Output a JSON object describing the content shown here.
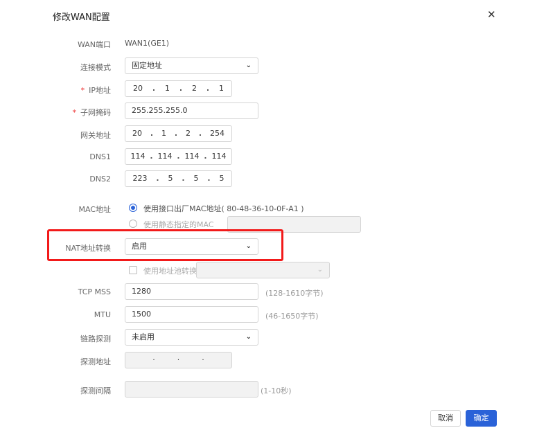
{
  "dialog": {
    "title": "修改WAN配置",
    "close_icon": "close-icon"
  },
  "fields": {
    "wan_port": {
      "label": "WAN端口",
      "value": "WAN1(GE1)"
    },
    "conn_mode": {
      "label": "连接模式",
      "value": "固定地址"
    },
    "ip": {
      "required": "*",
      "label": "IP地址",
      "octets": [
        "20",
        "1",
        "2",
        "1"
      ]
    },
    "subnet": {
      "required": "*",
      "label": "子网掩码",
      "value": "255.255.255.0"
    },
    "gateway": {
      "label": "网关地址",
      "octets": [
        "20",
        "1",
        "2",
        "254"
      ]
    },
    "dns1": {
      "label": "DNS1",
      "octets": [
        "114",
        "114",
        "114",
        "114"
      ]
    },
    "dns2": {
      "label": "DNS2",
      "octets": [
        "223",
        "5",
        "5",
        "5"
      ]
    },
    "mac": {
      "label": "MAC地址",
      "option_factory": "使用接口出厂MAC地址( 80-48-36-10-0F-A1 )",
      "option_static": "使用静态指定的MAC",
      "static_value": ""
    },
    "nat": {
      "label": "NAT地址转换",
      "value": "启用",
      "pool_option": "使用地址池转换",
      "pool_value": ""
    },
    "tcp_mss": {
      "label": "TCP MSS",
      "value": "1280",
      "hint": "(128-1610字节)"
    },
    "mtu": {
      "label": "MTU",
      "value": "1500",
      "hint": "(46-1650字节)"
    },
    "link_detect": {
      "label": "链路探测",
      "value": "未启用"
    },
    "detect_addr": {
      "label": "探测地址"
    },
    "detect_interval": {
      "label": "探测间隔",
      "value": "",
      "hint": "(1-10秒)"
    }
  },
  "buttons": {
    "cancel": "取消",
    "ok": "确定"
  },
  "colors": {
    "primary": "#2a62d8",
    "highlight": "#f21a1a"
  }
}
